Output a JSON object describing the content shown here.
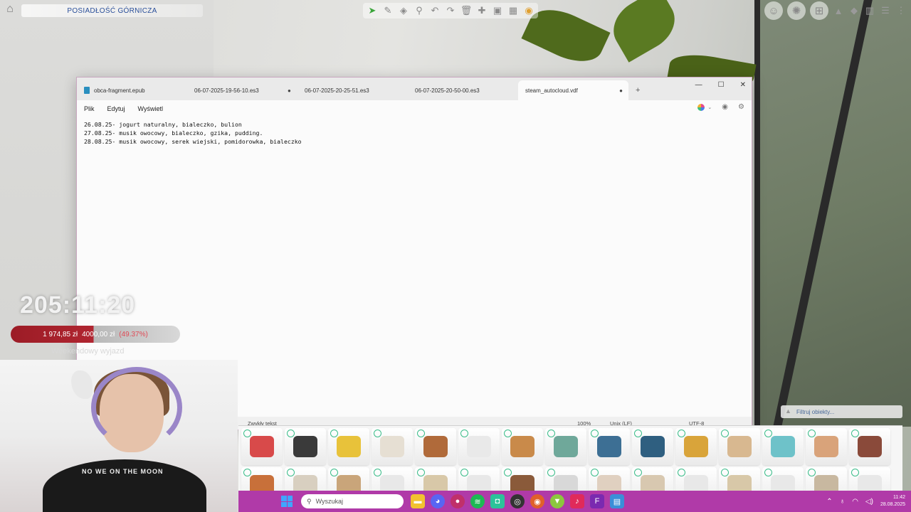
{
  "game": {
    "lot_name": "POSIADŁOŚĆ GÓRNICZA",
    "filter_placeholder": "Filtruj obiekty..."
  },
  "notepad": {
    "tabs": [
      {
        "label": "obca-fragment.epub",
        "dot": ""
      },
      {
        "label": "06-07-2025-19-56-10.es3",
        "dot": ""
      },
      {
        "label": "06-07-2025-20-25-51.es3",
        "dot": "●"
      },
      {
        "label": "06-07-2025-20-50-00.es3",
        "dot": ""
      },
      {
        "label": "steam_autocloud.vdf",
        "dot": "●"
      }
    ],
    "new_tab": "+",
    "controls": {
      "minimize": "—",
      "maximize": "☐",
      "close": "✕"
    },
    "menu": [
      "Plik",
      "Edytuj",
      "Wyświetl"
    ],
    "lines": [
      "26.08.25- jogurt naturalny, bialeczko, bulion",
      "27.08.25- musik owocowy, bialeczko, gzika, pudding.",
      "28.08.25- musik owocowy, serek wiejski, pomidorowka, bialeczko"
    ],
    "status": {
      "mode": "Zwykły tekst",
      "zoom": "100%",
      "line_ending": "Unix (LF)",
      "encoding": "UTF-8"
    }
  },
  "overlay": {
    "timer": "205:11:20",
    "donation_current": "1 974,85 zł",
    "donation_goal": "4000,00 zł",
    "donation_pct": "(49.37%)",
    "goal_label": "Weekendowy wyjazd"
  },
  "webcam": {
    "shirt_text": "NO WE ON THE MOON"
  },
  "catalog": {
    "colors": [
      "#d84a4a",
      "#3a3a3a",
      "#e8c23a",
      "#e6dfd3",
      "#b06a3a",
      "#e9e9e9",
      "#c98a4a",
      "#6fa89a",
      "#3d6f94",
      "#2f5f80",
      "#d9a43a",
      "#d8b890",
      "#6ec2c9",
      "#d9a37a",
      "#8a4a3a"
    ],
    "colors_row2": [
      "#c8703a",
      "#d8cfc0",
      "#c9a57a",
      "#e8e8e8",
      "#d8c8a8",
      "#e8e8e8",
      "#8a5a3a",
      "#d8d8d8",
      "#e0d0c0",
      "#d8c8b0",
      "#e8e8e8",
      "#d8c8a8",
      "#e8e8e8",
      "#c8b8a0",
      "#e8e8e8"
    ]
  },
  "taskbar": {
    "search_placeholder": "Wyszukaj",
    "time": "11:42",
    "date": "28.08.2025"
  }
}
